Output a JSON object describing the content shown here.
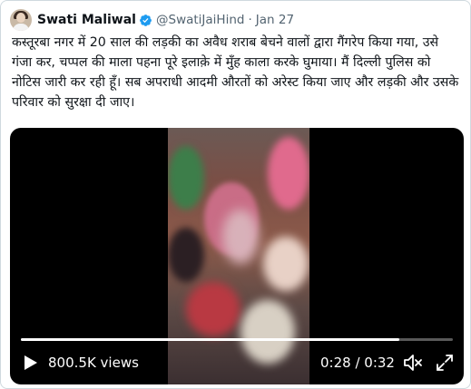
{
  "tweet": {
    "author_name": "Swati Maliwal",
    "handle": "@SwatiJaiHind",
    "separator": "·",
    "date": "Jan 27",
    "text": "कस्तूरबा नगर में 20 साल की लड़की का अवैध शराब बेचने वालों द्वारा गैंगरेप किया गया, उसे गंजा कर, चप्पल की माला पहना पूरे इलाक़े में मुँह काला करके घुमाया। मैं दिल्ली पुलिस को नोटिस जारी कर रही हूँ। सब अपराधी आदमी औरतों को अरेस्ट किया जाए और लड़की और उसके परिवार को सुरक्षा दी जाए।"
  },
  "video": {
    "views": "800.5K views",
    "time": "0:28 / 0:32",
    "progress": 0.875
  },
  "colors": {
    "verified": "#1d9bf0",
    "secondary_text": "#536471",
    "video_bg": "#000000"
  },
  "icons": [
    "verified-badge-icon",
    "play-icon",
    "volume-icon",
    "fullscreen-icon"
  ]
}
